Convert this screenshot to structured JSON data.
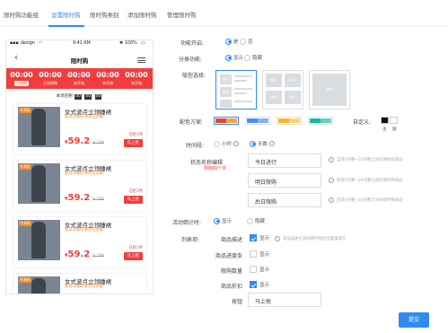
{
  "tabs": [
    {
      "label": "限时购功能组"
    },
    {
      "label": "设置限时购"
    },
    {
      "label": "限时购类别"
    },
    {
      "label": "添加限时购"
    },
    {
      "label": "管理限时购"
    }
  ],
  "phone": {
    "status": {
      "carrier": "design",
      "time": "9:41 AM",
      "battery": "100%"
    },
    "nav_title": "限时购",
    "slots": [
      {
        "time": "00:00",
        "status": "已抢购"
      },
      {
        "time": "00:00",
        "status": "正在抢购"
      },
      {
        "time": "00:00",
        "status": "未开始"
      },
      {
        "time": "00:00",
        "status": "未开始"
      },
      {
        "time": "00:00",
        "status": "未开始"
      }
    ],
    "countdown": {
      "prefix": "本场还剩",
      "h": "00",
      "m": "00",
      "s": "00"
    },
    "products": [
      {
        "tag": "9.8折",
        "title": "女式波点立领睡裙",
        "subtitle": "夏日必备的清凉出游服",
        "sold": "已抢1件",
        "price_sym": "¥",
        "price": "59.2",
        "orig": "¥ 299",
        "buy": "马上抢"
      },
      {
        "tag": "9.8折",
        "title": "女式波点立领睡裙",
        "subtitle": "夏日必备的清凉出游服",
        "sold": "已抢1件",
        "price_sym": "¥",
        "price": "59.2",
        "orig": "¥ 299",
        "buy": "马上抢"
      },
      {
        "tag": "9.8折",
        "title": "女式波点立领睡裙",
        "subtitle": "夏日必备的清凉出游服",
        "sold": "已抢1件",
        "price_sym": "¥",
        "price": "59.2",
        "orig": "¥ 299",
        "buy": "马上抢"
      },
      {
        "tag": "9.8折",
        "title": "女式波点立领睡裙",
        "subtitle": "夏日必备的清凉出游服",
        "sold": "",
        "price_sym": "",
        "price": "",
        "orig": "",
        "buy": ""
      }
    ]
  },
  "form": {
    "enable": {
      "label": "功能开启:",
      "yes": "是",
      "no": "否",
      "value": "是"
    },
    "category": {
      "label": "分类功能:",
      "show": "显示",
      "hide": "隐藏",
      "value": "显示"
    },
    "layout": {
      "label": "版型选择:",
      "img": "IMG"
    },
    "color": {
      "label": "配色方案:",
      "custom_label": "自定义:",
      "main": "主",
      "sub": "副",
      "swatches": [
        [
          "#e8452c",
          "#f7a24a"
        ],
        [
          "#4a8ef0",
          "#7fb3f5"
        ],
        [
          "#f2b824",
          "#f7d46b"
        ],
        [
          "#17b79b",
          "#5fd3bd"
        ]
      ]
    },
    "period": {
      "label": "时间段:",
      "hour": "小时",
      "day": "天数",
      "value": "天数"
    },
    "state_name": {
      "label": "状态名称编辑",
      "note": "限制四个字",
      "items": [
        {
          "value": "今日进行",
          "hint": "当日0点整~24点整之间的限时购商品"
        },
        {
          "value": "明日限购",
          "hint": "明日0点整~24点整之间的限时购商品"
        },
        {
          "value": "后日限购",
          "hint": "后日0点整~24点整之间的限时购商品"
        }
      ]
    },
    "countdown": {
      "label": "活动倒计时:",
      "show": "显示",
      "hide": "隐藏",
      "value": "显示"
    },
    "list": {
      "label": "列表项:",
      "items": [
        {
          "name": "商品描述",
          "option": "显示",
          "checked": true,
          "hint": "商品描述在添加限时购边页面里填写"
        },
        {
          "name": "商品进度条",
          "option": "显示",
          "checked": false,
          "hint": ""
        },
        {
          "name": "限购数量",
          "option": "显示",
          "checked": false,
          "hint": ""
        },
        {
          "name": "商品折扣",
          "option": "显示",
          "checked": true,
          "hint": ""
        }
      ]
    },
    "button": {
      "label": "按钮",
      "value": "马上抢"
    }
  },
  "submit_label": "提交",
  "colors": {
    "accent": "#2e8cf0",
    "red": "#f23d3d",
    "orange": "#f28c2e"
  }
}
